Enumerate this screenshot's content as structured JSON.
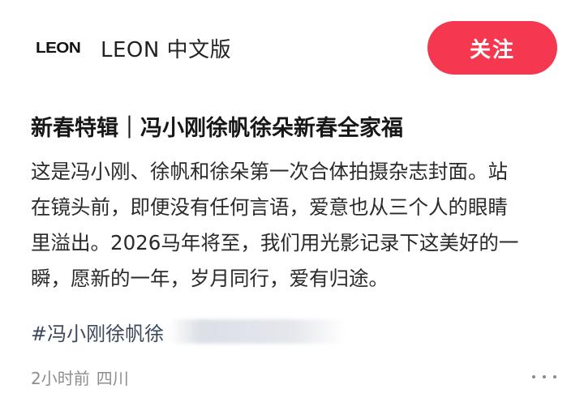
{
  "account": {
    "logo_text": "LEON",
    "name": "LEON 中文版",
    "follow_label": "关注"
  },
  "post": {
    "title": "新春特辑｜冯小刚徐帆徐朵新春全家福",
    "body_lines": [
      "这是冯小刚、徐帆和徐朵第一次合体拍摄杂志封面。站",
      "在镜头前，即便没有任何言语，爱意也从三个人的眼睛",
      "里溢出。2026马年将至，我们用光影记录下这美好的一",
      "瞬，愿新的一年，岁月同行，爱有归途。"
    ],
    "hashtag": "#冯小刚徐帆徐",
    "time": "2小时前",
    "location": "四川"
  },
  "icons": {
    "more": "more-dots-icon"
  },
  "colors": {
    "follow_button": "#f5384f",
    "hashtag": "#3d4a5c",
    "meta": "#8e8e8e"
  }
}
